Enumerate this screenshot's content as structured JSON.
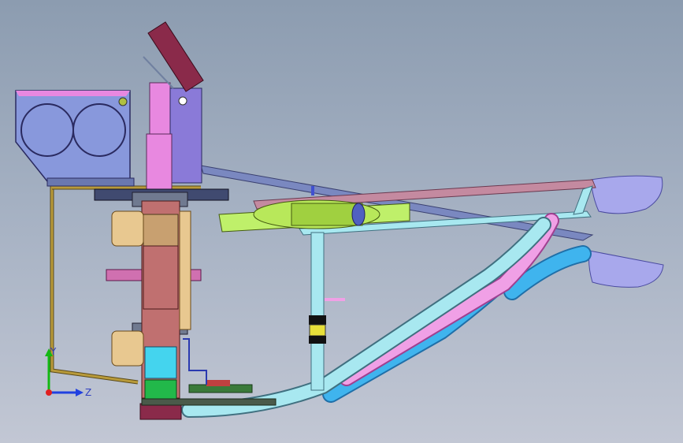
{
  "viewport": {
    "background_top": "#8c9cb0",
    "background_bottom": "#c2c7d4"
  },
  "model": {
    "parts": [
      "camera-bracket",
      "upright-plate",
      "main-column",
      "sprocket-assembly",
      "pulley-wheel",
      "linear-actuator",
      "base-plate",
      "frame-tubes",
      "wing-panels"
    ],
    "colors": {
      "tube_cyan": "#a8e8f0",
      "tube_blue": "#3fb4ee",
      "tube_pink": "#f0a0e6",
      "column": "#c07070",
      "bracket": "#8898dc",
      "pulley": "#bff06a",
      "plate_dark": "#8a2a4a",
      "wing": "#a8a8ec"
    }
  },
  "triad": {
    "y_label": "Y",
    "z_label": "Z"
  }
}
